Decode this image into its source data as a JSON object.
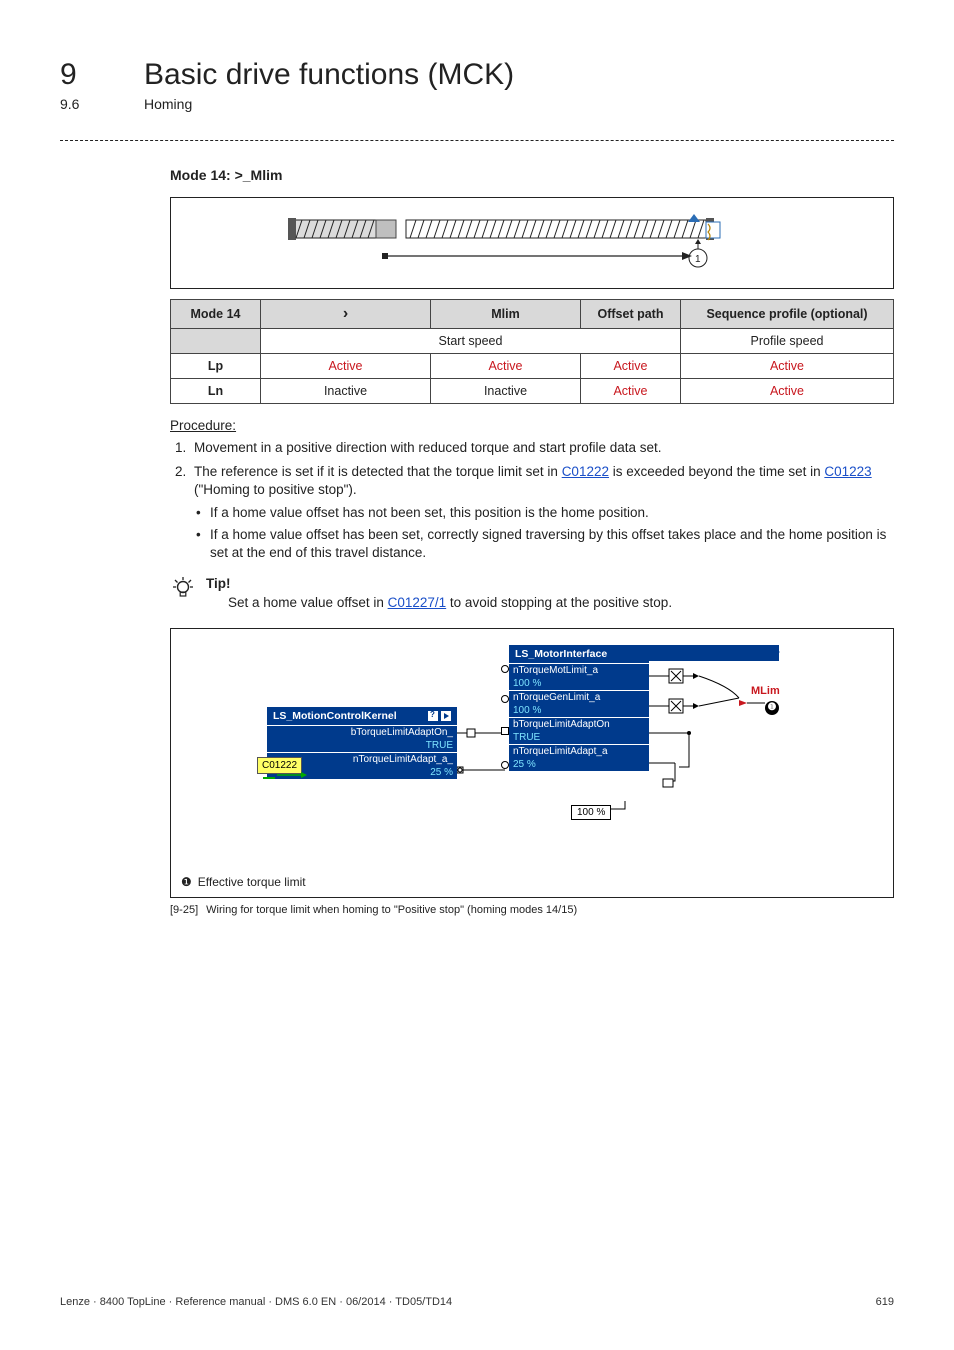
{
  "header": {
    "chapter_num": "9",
    "chapter_title": "Basic drive functions (MCK)",
    "section_num": "9.6",
    "section_title": "Homing"
  },
  "mode_title": "Mode 14: >_Mlim",
  "table": {
    "hdr_mode": "Mode 14",
    "hdr_dir": "›",
    "hdr_mlim": "Mlim",
    "hdr_offset": "Offset path",
    "hdr_seq": "Sequence profile (optional)",
    "start_speed": "Start speed",
    "profile_speed": "Profile speed",
    "row_lp": {
      "label": "Lp",
      "c1": "Active",
      "c2": "Active",
      "c3": "Active",
      "c4": "Active"
    },
    "row_ln": {
      "label": "Ln",
      "c1": "Inactive",
      "c2": "Inactive",
      "c3": "Active",
      "c4": "Active"
    }
  },
  "procedure": {
    "title": "Procedure:",
    "step1": "Movement in a positive direction with reduced torque and start profile data set.",
    "step2_a": "The reference is set if it is detected that the torque limit set in ",
    "step2_link1": "C01222",
    "step2_b": " is exceeded beyond the time set in ",
    "step2_link2": "C01223",
    "step2_c": " (\"Homing to positive stop\").",
    "sub1": "If a home value offset has not been set, this position is the home position.",
    "sub2": "If a home value offset has been set, correctly signed traversing by this offset takes place and the home position is set at the end of this travel distance."
  },
  "tip": {
    "label": "Tip!",
    "text_a": "Set a home value offset in ",
    "link": "C01227/1",
    "text_b": " to avoid stopping at the positive stop."
  },
  "figure": {
    "fb1_title": "LS_MotionControlKernel",
    "fb1_port1": "bTorqueLimitAdaptOn_",
    "fb1_val1": "TRUE",
    "fb1_port2": "nTorqueLimitAdapt_a_",
    "fb1_val2": "25 %",
    "fb1_param": "C01222",
    "fb2_title": "LS_MotorInterface",
    "fb2_port1": "nTorqueMotLimit_a",
    "fb2_val1": "100 %",
    "fb2_port2": "nTorqueGenLimit_a",
    "fb2_val2": "100 %",
    "fb2_port3": "bTorqueLimitAdaptOn",
    "fb2_val3": "TRUE",
    "fb2_port4": "nTorqueLimitAdapt_a",
    "fb2_val4": "25 %",
    "mlim": "MLim",
    "box100": "100 %",
    "footnote": "Effective torque limit",
    "caption_tag": "[9-25]",
    "caption": "Wiring for torque limit when homing to \"Positive stop\" (homing modes 14/15)"
  },
  "footer": {
    "left": "Lenze · 8400 TopLine · Reference manual · DMS 6.0 EN · 06/2014 · TD05/TD14",
    "right": "619"
  }
}
